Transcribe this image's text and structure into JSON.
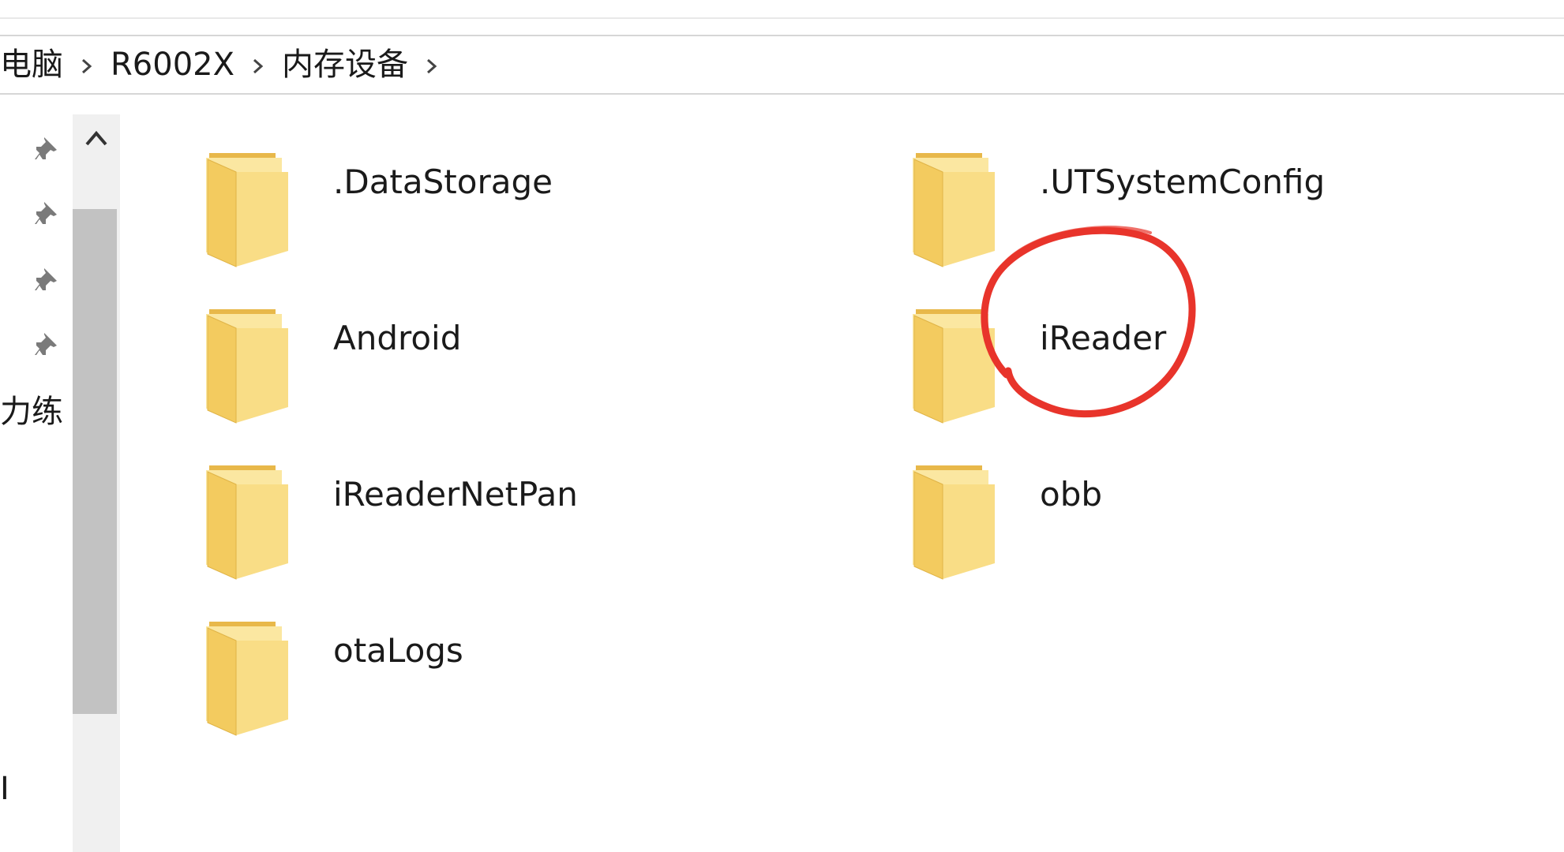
{
  "breadcrumb": {
    "items": [
      "电脑",
      "R6002X",
      "内存设备"
    ],
    "separator_icon": "chevron-right-icon"
  },
  "nav_pane": {
    "pins": [
      "pin-icon",
      "pin-icon",
      "pin-icon",
      "pin-icon"
    ],
    "partial_text_1": "力练",
    "partial_text_2": "I"
  },
  "scrollbar": {
    "up_icon": "chevron-up-icon"
  },
  "files": [
    {
      "name": ".DataStorage",
      "icon": "folder-icon"
    },
    {
      "name": ".UTSystemConfig",
      "icon": "folder-icon"
    },
    {
      "name": "Android",
      "icon": "folder-icon"
    },
    {
      "name": "iReader",
      "icon": "folder-icon"
    },
    {
      "name": "iReaderNetPan",
      "icon": "folder-icon"
    },
    {
      "name": "obb",
      "icon": "folder-icon"
    },
    {
      "name": "otaLogs",
      "icon": "folder-icon"
    }
  ],
  "colors": {
    "folder": "#f7d97c",
    "annotation": "#e8342b"
  }
}
